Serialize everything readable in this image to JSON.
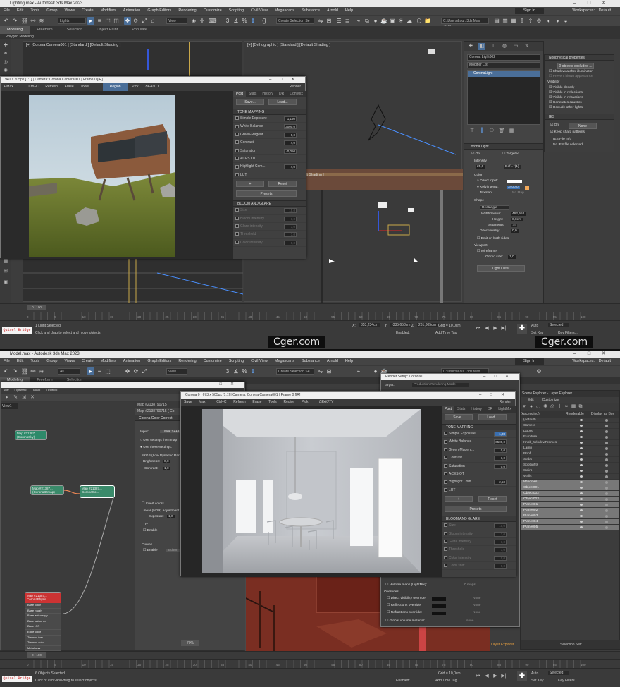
{
  "top": {
    "window_title": "Lighting.max - Autodesk 3ds Max 2023",
    "menu": [
      "File",
      "Edit",
      "Tools",
      "Group",
      "Views",
      "Create",
      "Modifiers",
      "Animation",
      "Graph Editors",
      "Rendering",
      "Customize",
      "Scripting",
      "Civil View",
      "Megascans",
      "Substance",
      "Arnold",
      "Help"
    ],
    "signin": "Sign In",
    "workspaces_label": "Workspaces:",
    "workspaces_value": "Default",
    "toolbar": {
      "layer": "Lights",
      "view": "View",
      "selection_set": "Create Selection Se",
      "project_path": "C:\\Users\\Lou...3ds Max 2023"
    },
    "ribbon_tabs": [
      "Modeling",
      "Freeform",
      "Selection",
      "Object Paint",
      "Populate"
    ],
    "ribbon_sub": "Polygon Modeling",
    "vp_left_label": "[+] [Corona Camera001 ] [Standard ] [Default Shading ]",
    "vp_right_label": "[+] [Orthographic ] [Standard ] [Default Shading ]",
    "vp_mid_label": "ault Shading ]",
    "vfb": {
      "title": "940 x 705px [1:1] | Camera: Corona Camera001 | Frame 0 [IR]",
      "tools": [
        "+ Max",
        "Ctrl+C",
        "Refresh",
        "Erase",
        "Tools",
        "Region",
        "Pick",
        "BEAUTY",
        "Render"
      ],
      "tabs": [
        "Post",
        "Stats",
        "History",
        "DR",
        "LightMix"
      ],
      "save": "Save...",
      "load": "Load...",
      "tone_mapping": "TONE MAPPING",
      "rows": [
        {
          "label": "Simple Exposure",
          "value": "1,150"
        },
        {
          "label": "White Balance",
          "value": "3000,0"
        },
        {
          "label": "Green-Magent...",
          "value": "0,0"
        },
        {
          "label": "Contrast",
          "value": "4,0"
        },
        {
          "label": "Saturation",
          "value": "-0,050"
        },
        {
          "label": "ACES OT",
          "value": ""
        },
        {
          "label": "Highlight Com...",
          "value": "4,0"
        },
        {
          "label": "LUT",
          "value": ""
        }
      ],
      "plus": "+",
      "reset": "Reset",
      "presets": "Presets",
      "bloom": "BLOOM AND GLARE",
      "bloom_rows": [
        {
          "label": "Size",
          "value": "15,0"
        },
        {
          "label": "Bloom intensity",
          "value": "1,0"
        },
        {
          "label": "Glare intensity",
          "value": "1,0"
        },
        {
          "label": "Threshold",
          "value": "1,0"
        },
        {
          "label": "Color intensity",
          "value": "0,0"
        }
      ]
    },
    "cmd": {
      "object_name": "Corona Light002",
      "modifier_list": "Modifier List",
      "stack_item": "CoronaLight",
      "rollout": "Corona Light",
      "on": "On",
      "targeted": "Targeted",
      "intensity_label": "Intensity",
      "intensity_value": "25,0",
      "intensity_unit": "Def...^(1)",
      "color_label": "Color",
      "direct_input": "Direct input:",
      "kelvin": "Kelvin temp:",
      "kelvin_value": "3400,0",
      "texmap": "Texmap:",
      "texmap_value": "No Map",
      "shape_label": "Shape",
      "shape_value": "Rectangle",
      "width": "Width/radius:",
      "width_value": "462,552",
      "height": "Height:",
      "height_value": "0,0cm",
      "segments": "Segments:",
      "segments_value": "16",
      "directionality": "Directionality:",
      "directionality_value": "0,0",
      "emit_both": "Emit on both sides",
      "viewport": "Viewport",
      "wireframe": "Wireframe",
      "gizmo": "Gizmo size:",
      "gizmo_value": "1,0",
      "lister": "Light Lister",
      "nonphys": "Nonphysical properties",
      "excluded": "0 objects excluded ...",
      "shadowcatcher": "Shadowcatcher illuminator",
      "prevent_blown": "Prevent blown appearance",
      "visibility": "Visibility",
      "vis_items": [
        "Visible directly",
        "Visible in reflections",
        "Visible in refractions",
        "Generates caustics",
        "Occlude other lights"
      ],
      "ies": "IES",
      "ies_on": "On",
      "ies_none": "None",
      "keep_sharp": "Keep sharp patterns",
      "ies_info_title": "IES File Info",
      "ies_info": "No IES file selected."
    },
    "time": {
      "frame": "0 / 100",
      "ticks": [
        "0",
        "5",
        "10",
        "15",
        "20",
        "25",
        "30",
        "35",
        "40",
        "45",
        "50",
        "55",
        "60",
        "65",
        "70",
        "75",
        "80",
        "85",
        "90",
        "95",
        "100"
      ]
    },
    "status": {
      "quixel": "Quixel Bridge",
      "line1": "1 Light Selected",
      "line2": "Click and drag to select and move objects",
      "x_label": "X:",
      "x": "353,234cm",
      "y_label": "Y:",
      "y": "-335,658cm",
      "z_label": "Z:",
      "z": "281,805cm",
      "grid": "Grid = 10,0cm",
      "enabled": "Enabled:",
      "add_tag": "Add Time Tag",
      "auto": "Auto",
      "selected": "Selected",
      "setkey": "Set Key",
      "keyfilters": "Key Filters..."
    },
    "watermark_center": "Cger.com",
    "watermark_right": "Cger.com"
  },
  "bottom": {
    "window_title": "Model.max - Autodesk 3ds Max 2023",
    "menu": [
      "File",
      "Edit",
      "Tools",
      "Group",
      "Views",
      "Create",
      "Modifiers",
      "Animation",
      "Graph Editors",
      "Rendering",
      "Customize",
      "Scripting",
      "Civil View",
      "Megascans",
      "Substance",
      "Arnold",
      "Help"
    ],
    "signin": "Sign In",
    "workspaces_label": "Workspaces:",
    "workspaces_value": "Default",
    "toolbar": {
      "layer": "All",
      "view": "View",
      "selection_set": "Create Selection Se",
      "project_path": "C:\\Users\\Lou...3ds Max 2023"
    },
    "ribbon_tabs": [
      "Modeling",
      "Freeform",
      "Selection"
    ],
    "slate_menu": [
      "iew",
      "Options",
      "Tools",
      "Utilities"
    ],
    "slate_view": "View1",
    "map_header": "Map #2138790715",
    "map_sub": "Map #2138790715 ( Co",
    "color_correct": "Corona Color Correct",
    "input_label": "Input:",
    "input_value": "Map #213...",
    "use_from_map": "Use settings from map",
    "use_these": "Use these settings:",
    "srgb": "sRGB (Low Dynamic Range",
    "brightness": "Brightness:",
    "brightness_value": "0,0",
    "contrast": "Contrast:",
    "contrast_value": "1,0",
    "invert": "Invert colors",
    "linear": "Linear (HDR) Adjustment",
    "exposure": "Exposure:",
    "exposure_value": "1,0",
    "lut": "LUT",
    "enable": "Enable",
    "curves": "Curves",
    "enable2": "Enable",
    "editor": "Editor",
    "nodes": {
      "n1": "Map #21387...\n(CoronaSky)",
      "n2": "Map #21387...\n(CoronaBitmap)",
      "n3": "Map #21387...\nCoronaCo...",
      "n4": "Map #21387...\nCoronaPhysic"
    },
    "mat_slots": [
      "Base color",
      "Base rough",
      "Base anisotropy",
      "Base aniso. rot",
      "Base IOR",
      "Edge color",
      "Translu. frac",
      "Translu. color",
      "Metalness",
      "Reflection amount",
      "Thin absorption",
      "Opacity color",
      "Self-illum",
      "Displacement",
      "Bump",
      "Sheen",
      "Clearcoat amount",
      "Clearcoat IOR",
      "Clearcoat rough"
    ],
    "zoom": "70%",
    "render_setup_title": "Render Setup: Corona 0",
    "target_label": "Target:",
    "target_value": "Production Rendering Mode",
    "vfb": {
      "title": "Corona 0 | 673 x 505px [1:1] | Camera: Corona Camera001 | Frame 0 [IR]",
      "tools": [
        "Save",
        "Max",
        "Ctrl+C",
        "Refresh",
        "Erase",
        "Tools",
        "Region",
        "Pick",
        "BEAUTY",
        "Render"
      ],
      "tabs": [
        "Post",
        "Stats",
        "History",
        "DR",
        "LightMix"
      ],
      "save": "Save...",
      "load": "Load...",
      "tone_mapping": "TONE MAPPING",
      "rows": [
        {
          "label": "Simple Exposure",
          "value": "1,20"
        },
        {
          "label": "White Balance",
          "value": "6500,0"
        },
        {
          "label": "Green-Magent...",
          "value": "0,0"
        },
        {
          "label": "Contrast",
          "value": "1,0"
        },
        {
          "label": "Saturation",
          "value": "0,0"
        },
        {
          "label": "ACES OT",
          "value": ""
        },
        {
          "label": "Highlight Com...",
          "value": "2,50"
        },
        {
          "label": "LUT",
          "value": ""
        }
      ],
      "plus": "+",
      "reset": "Reset",
      "presets": "Presets",
      "bloom": "BLOOM AND GLARE",
      "bloom_rows": [
        {
          "label": "Size",
          "value": "15,0"
        },
        {
          "label": "Bloom intensity",
          "value": "1,0"
        },
        {
          "label": "Glare intensity",
          "value": "1,0"
        },
        {
          "label": "Threshold",
          "value": "1,0"
        },
        {
          "label": "Color intensity",
          "value": "0,0"
        },
        {
          "label": "Color shift",
          "value": "0,0"
        }
      ]
    },
    "overrides": {
      "multiple_maps": "Multiple maps (LightMix):",
      "multiple_value": "0 maps",
      "title": "Overrides",
      "direct": "Direct visibility override:",
      "refl": "Reflections override:",
      "refr": "Refractions override:",
      "none": "None",
      "global": "Global volume material:",
      "global_value": "None"
    },
    "scene_explorer": {
      "title": "Scene Explorer - Layer Explorer",
      "menu": [
        "Edit",
        "Customize"
      ],
      "columns": [
        "(Ascending)",
        "Renderable",
        "Display as Box"
      ],
      "rows": [
        {
          "name": "(default)",
          "sel": false
        },
        {
          "name": "Camera",
          "sel": false
        },
        {
          "name": "Doors",
          "sel": false
        },
        {
          "name": "Furniture",
          "sel": false
        },
        {
          "name": "Knob_WindowFrames",
          "sel": false
        },
        {
          "name": "Lamp",
          "sel": false
        },
        {
          "name": "Roof",
          "sel": false
        },
        {
          "name": "Slabs",
          "sel": false
        },
        {
          "name": "Spotlights",
          "sel": false
        },
        {
          "name": "Stairs",
          "sel": false
        },
        {
          "name": "Walls",
          "sel": false
        },
        {
          "name": "Windows",
          "sel": true
        },
        {
          "name": "Object001",
          "sel": true
        },
        {
          "name": "Object002",
          "sel": true
        },
        {
          "name": "Object003",
          "sel": true
        },
        {
          "name": "Plane001",
          "sel": true
        },
        {
          "name": "Plane002",
          "sel": true
        },
        {
          "name": "Plane003",
          "sel": true
        },
        {
          "name": "Plane004",
          "sel": true
        },
        {
          "name": "Plane005",
          "sel": true
        }
      ],
      "footer_left": "Layer Explorer",
      "footer_right": "Selection Set:"
    },
    "time": {
      "frame": "0 / 100",
      "ticks": [
        "0",
        "5",
        "10",
        "15",
        "20",
        "25",
        "30",
        "35",
        "40",
        "45",
        "50",
        "55",
        "60",
        "65",
        "70",
        "75",
        "80",
        "85",
        "90",
        "95",
        "100"
      ]
    },
    "status": {
      "quixel": "Quixel Bridge",
      "line1": "6 Objects Selected",
      "line2": "Click or click-and-drag to select objects",
      "grid": "Grid = 10,0cm",
      "enabled": "Enabled:",
      "add_tag": "Add Time Tag",
      "auto": "Auto",
      "selected": "Selected",
      "setkey": "Set Key",
      "keyfilters": "Key Filters..."
    }
  }
}
